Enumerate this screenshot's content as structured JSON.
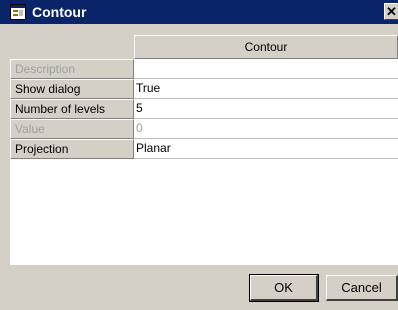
{
  "window": {
    "title": "Contour",
    "close_symbol": "✕"
  },
  "grid": {
    "column_header": "Contour",
    "rows": [
      {
        "label": "Description",
        "value": "",
        "disabled": true
      },
      {
        "label": "Show dialog",
        "value": "True",
        "disabled": false
      },
      {
        "label": "Number of levels",
        "value": "5",
        "disabled": false
      },
      {
        "label": "Value",
        "value": "0",
        "disabled": true
      },
      {
        "label": "Projection",
        "value": "Planar",
        "disabled": false
      }
    ]
  },
  "buttons": {
    "ok_label": "OK",
    "cancel_label": "Cancel"
  },
  "colors": {
    "titlebar": "#0a246a",
    "face": "#d4d0c8",
    "disabled_text": "#a0a0a0"
  },
  "icons": {
    "title_icon": "app-window-icon",
    "close_icon": "close-icon"
  }
}
